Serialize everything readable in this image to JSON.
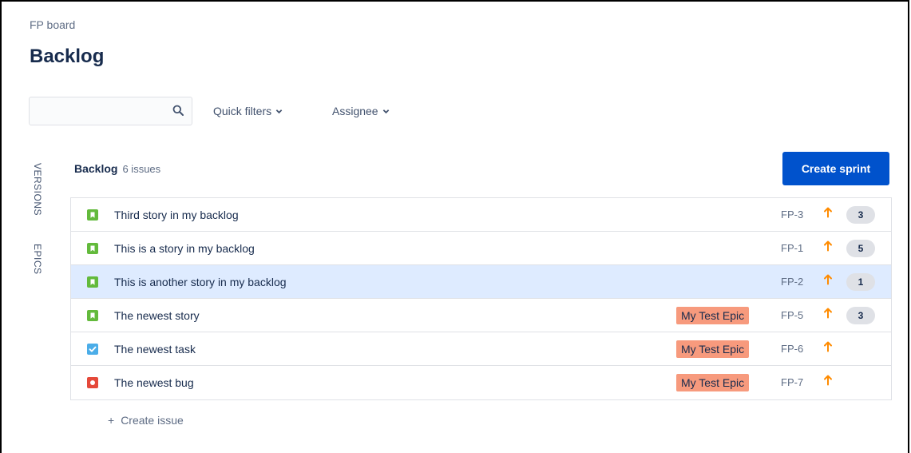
{
  "breadcrumb": "FP board",
  "title": "Backlog",
  "search": {
    "value": "",
    "placeholder": ""
  },
  "filters": {
    "quick": "Quick filters",
    "assignee": "Assignee"
  },
  "side_tabs": {
    "versions": "VERSIONS",
    "epics": "EPICS"
  },
  "backlog": {
    "name": "Backlog",
    "count": "6 issues",
    "create_sprint": "Create sprint"
  },
  "issues": [
    {
      "type": "story",
      "summary": "Third story in my backlog",
      "epic": "",
      "key": "FP-3",
      "estimate": "3",
      "selected": false
    },
    {
      "type": "story",
      "summary": "This is a story in my backlog",
      "epic": "",
      "key": "FP-1",
      "estimate": "5",
      "selected": false
    },
    {
      "type": "story",
      "summary": "This is another story in my backlog",
      "epic": "",
      "key": "FP-2",
      "estimate": "1",
      "selected": true
    },
    {
      "type": "story",
      "summary": "The newest story",
      "epic": "My Test Epic",
      "key": "FP-5",
      "estimate": "3",
      "selected": false
    },
    {
      "type": "task",
      "summary": "The newest task",
      "epic": "My Test Epic",
      "key": "FP-6",
      "estimate": "",
      "selected": false
    },
    {
      "type": "bug",
      "summary": "The newest bug",
      "epic": "My Test Epic",
      "key": "FP-7",
      "estimate": "",
      "selected": false
    }
  ],
  "create_issue": "Create issue",
  "colors": {
    "primary": "#0052cc",
    "story": "#63ba3c",
    "task": "#4bade8",
    "bug": "#e5493a",
    "priority_high": "#ff8b00",
    "epic_label": "#f79a7d",
    "selected_row": "#deebff"
  }
}
